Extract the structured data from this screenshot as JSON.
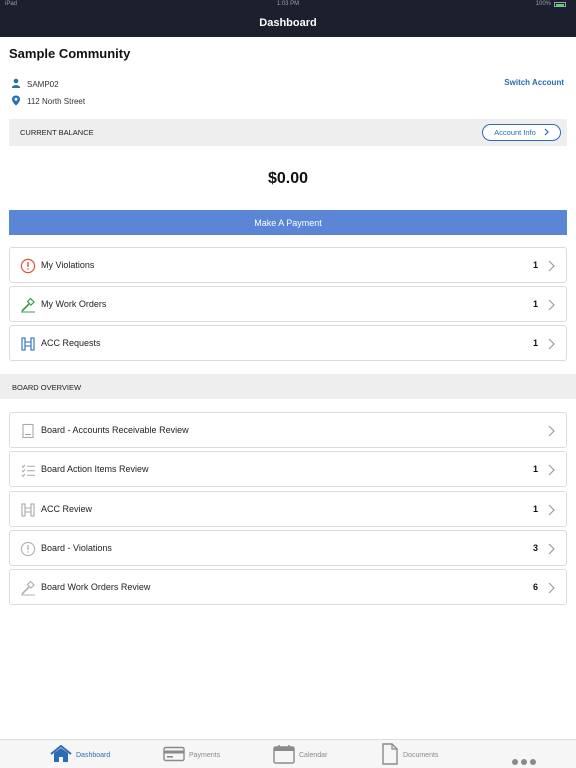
{
  "status": {
    "carrier": "iPad",
    "time": "1:03 PM",
    "battery": "100%"
  },
  "nav": {
    "title": "Dashboard"
  },
  "community": {
    "name": "Sample Community",
    "account_id": "SAMP02",
    "address": "112 North Street",
    "switch_label": "Switch Account"
  },
  "balance": {
    "label": "CURRENT BALANCE",
    "account_info_label": "Account Info",
    "amount": "$0.00"
  },
  "payment": {
    "label": "Make A Payment"
  },
  "my_items": [
    {
      "label": "My Violations",
      "count": "1",
      "icon": "alert-circle-icon"
    },
    {
      "label": "My Work Orders",
      "count": "1",
      "icon": "hammer-icon"
    },
    {
      "label": "ACC Requests",
      "count": "1",
      "icon": "fence-icon"
    }
  ],
  "board": {
    "title": "BOARD OVERVIEW",
    "items": [
      {
        "label": "Board - Accounts Receivable Review",
        "count": "",
        "icon": "ledger-icon"
      },
      {
        "label": "Board Action Items Review",
        "count": "1",
        "icon": "checklist-icon"
      },
      {
        "label": "ACC Review",
        "count": "1",
        "icon": "fence-icon"
      },
      {
        "label": "Board - Violations",
        "count": "3",
        "icon": "alert-circle-icon"
      },
      {
        "label": "Board Work Orders Review",
        "count": "6",
        "icon": "hammer-icon"
      }
    ]
  },
  "tabs": [
    {
      "label": "Dashboard",
      "icon": "home-icon",
      "active": true
    },
    {
      "label": "Payments",
      "icon": "credit-card-icon",
      "active": false
    },
    {
      "label": "Calendar",
      "icon": "calendar-icon",
      "active": false
    },
    {
      "label": "Documents",
      "icon": "document-icon",
      "active": false
    }
  ],
  "colors": {
    "nav_bg": "#1b1f2e",
    "accent": "#2a6db5",
    "pay_button": "#5b86d6",
    "alert": "#e0533d",
    "work_order": "#3c9a4a"
  }
}
